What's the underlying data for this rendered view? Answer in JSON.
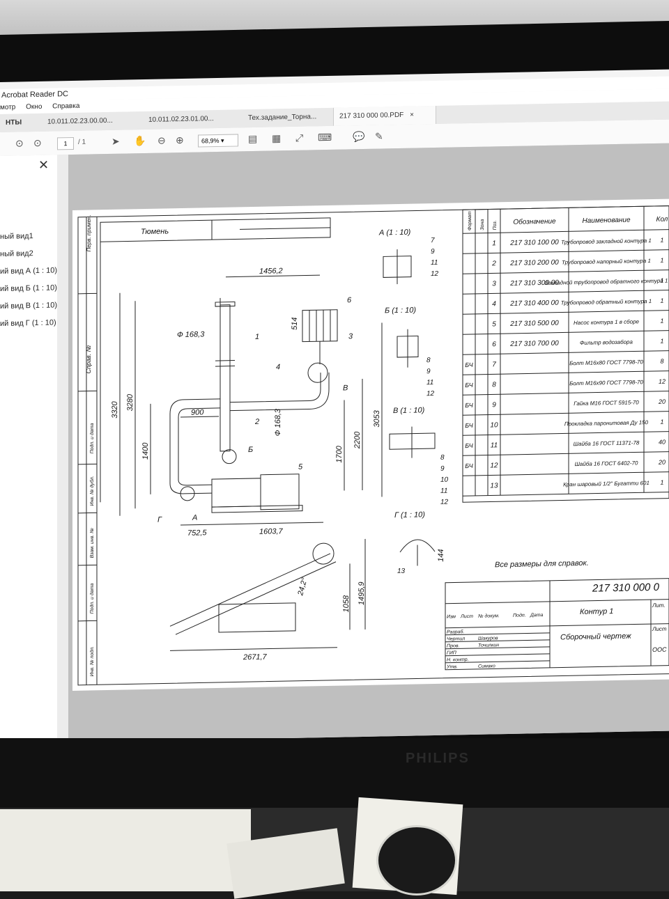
{
  "app": {
    "title": "Acrobat Reader DC",
    "menu": [
      "мотр",
      "Окно",
      "Справка"
    ],
    "tabs": [
      {
        "label": "НТЫ"
      },
      {
        "label": "10.011.02.23.00.00..."
      },
      {
        "label": "10.011.02.23.01.00..."
      },
      {
        "label": "Тех.задание_Торна..."
      },
      {
        "label": "217 310 000 00.PDF",
        "close": "×"
      }
    ],
    "page_current": "1",
    "page_total": "/ 1",
    "zoom": "68,9%"
  },
  "sidebar": {
    "close": "✕",
    "items": [
      {
        "label": "ный вид1"
      },
      {
        "label": "ный вид2"
      },
      {
        "label": "ий вид А (1 : 10)"
      },
      {
        "label": "ий вид Б (1 : 10)"
      },
      {
        "label": "ий вид В (1 : 10)"
      },
      {
        "label": "ий вид Г (1 : 10)"
      }
    ]
  },
  "drawing": {
    "city": "Тюмень",
    "left_strip": [
      "Перв. примен.",
      "Справ. №",
      "Подп. и дата",
      "Инв. № дубл.",
      "Взам. инв. №",
      "Подп. и дата",
      "Инв. № подл."
    ],
    "dims": [
      "1456,2",
      "Ф 168,3",
      "514",
      "3320",
      "3280",
      "1400",
      "900",
      "Ф 168,3",
      "1700",
      "2200",
      "3053",
      "752,5",
      "1603,7",
      "24,2°",
      "1058",
      "1495,9",
      "2671,7",
      "144"
    ],
    "callouts": [
      "1",
      "2",
      "3",
      "4",
      "5",
      "6",
      "А",
      "Б",
      "В",
      "Г"
    ],
    "views": {
      "a": {
        "title": "А (1 : 10)",
        "nums": [
          "7",
          "9",
          "11",
          "12"
        ]
      },
      "b": {
        "title": "Б (1 : 10)",
        "nums": [
          "8",
          "9",
          "11",
          "12"
        ]
      },
      "v": {
        "title": "В (1 : 10)",
        "nums": [
          "8",
          "9",
          "10",
          "11",
          "12"
        ]
      },
      "g": {
        "title": "Г (1 : 10)",
        "nums": [
          "13"
        ]
      }
    },
    "note": "Все размеры для справок.",
    "spec_headers": [
      "Формат",
      "Зона",
      "Поз.",
      "Обозначение",
      "Наименование",
      "Кол"
    ],
    "spec_rows": [
      {
        "fmt": "",
        "pos": "1",
        "code": "217 310 100 00",
        "name": "Трубопровод закладной контура 1",
        "qty": "1"
      },
      {
        "fmt": "",
        "pos": "2",
        "code": "217 310 200 00",
        "name": "Трубопровод напорный контура 1",
        "qty": "1"
      },
      {
        "fmt": "",
        "pos": "3",
        "code": "217 310 300 00",
        "name": "Закладной трубопровод обратного контура 1",
        "qty": "1"
      },
      {
        "fmt": "",
        "pos": "4",
        "code": "217 310 400 00",
        "name": "Трубопровод обратный контура 1",
        "qty": "1"
      },
      {
        "fmt": "",
        "pos": "5",
        "code": "217 310 500 00",
        "name": "Насос контура 1 в сборе",
        "qty": "1"
      },
      {
        "fmt": "",
        "pos": "6",
        "code": "217 310 700 00",
        "name": "Фильтр водозабора",
        "qty": "1"
      },
      {
        "fmt": "БЧ",
        "pos": "7",
        "code": "",
        "name": "Болт М16х80 ГОСТ 7798-70",
        "qty": "8"
      },
      {
        "fmt": "БЧ",
        "pos": "8",
        "code": "",
        "name": "Болт М16х90 ГОСТ 7798-70",
        "qty": "12"
      },
      {
        "fmt": "БЧ",
        "pos": "9",
        "code": "",
        "name": "Гайка М16 ГОСТ 5915-70",
        "qty": "20"
      },
      {
        "fmt": "БЧ",
        "pos": "10",
        "code": "",
        "name": "Прокладка паронитовая Ду 150",
        "qty": "1"
      },
      {
        "fmt": "БЧ",
        "pos": "11",
        "code": "",
        "name": "Шайба 16 ГОСТ 11371-78",
        "qty": "40"
      },
      {
        "fmt": "БЧ",
        "pos": "12",
        "code": "",
        "name": "Шайба 16 ГОСТ 6402-70",
        "qty": "20"
      },
      {
        "fmt": "",
        "pos": "13",
        "code": "",
        "name": "Кран шаровый 1/2\" Бугатти 601",
        "qty": "1"
      }
    ],
    "stamp": {
      "doc_number": "217 310 000 0",
      "title": "Контур 1",
      "subtitle": "Сборочный чертеж",
      "lit": "Лит.",
      "list": "Лист",
      "org": "ООС",
      "header_cells": [
        "Изм",
        "Лист",
        "№ докум.",
        "Подп.",
        "Дата"
      ],
      "rows": [
        {
          "role": "Разраб.",
          "name": ""
        },
        {
          "role": "Чертил",
          "name": "Шакуров"
        },
        {
          "role": "Пров.",
          "name": "Точилкин"
        },
        {
          "role": "ГИП",
          "name": ""
        },
        {
          "role": "Н. контр.",
          "name": ""
        },
        {
          "role": "Утв.",
          "name": "Симако"
        }
      ]
    }
  },
  "monitor": {
    "brand": "PHILIPS"
  }
}
